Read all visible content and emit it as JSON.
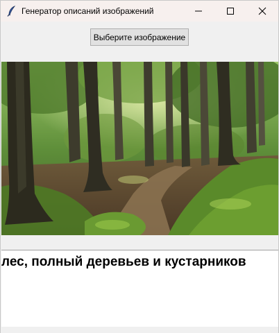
{
  "window": {
    "title": "Генератор описаний изображений",
    "app_icon": "feather-icon",
    "controls": [
      "minimize-icon",
      "maximize-icon",
      "close-icon"
    ]
  },
  "toolbar": {
    "select_button_label": "Выберите изображение"
  },
  "image": {
    "subject": "forest-photo"
  },
  "description": {
    "text": "лес, полный деревьев и кустарников"
  },
  "colors": {
    "titlebar_bg": "#f7f0ee",
    "window_bg": "#f0f0f0",
    "text_area_bg": "#ffffff"
  }
}
